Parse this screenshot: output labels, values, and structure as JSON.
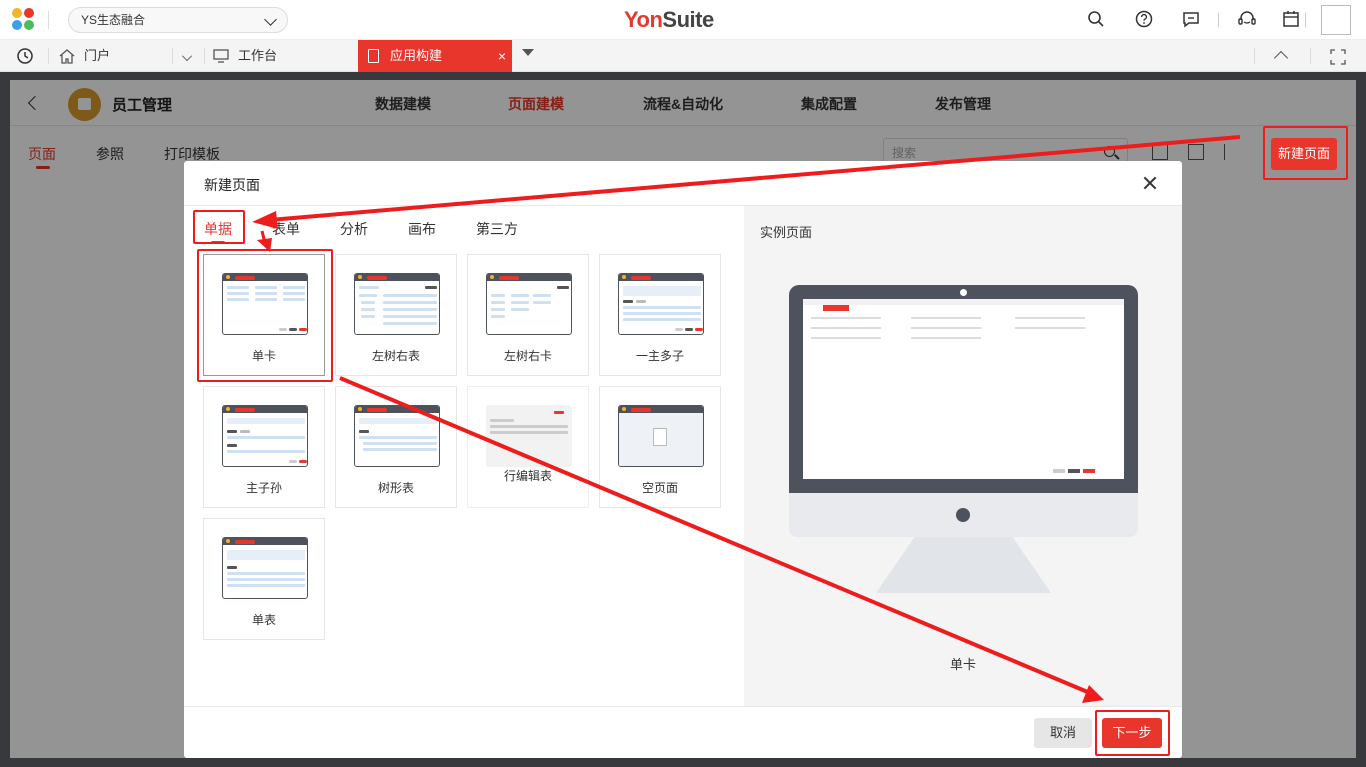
{
  "topbar": {
    "tenant": "YS生态融合",
    "brand_a": "Yon",
    "brand_b": "Suite",
    "icons": [
      "search-icon",
      "help-icon",
      "message-icon",
      "service-icon",
      "calendar-icon",
      "avatar"
    ]
  },
  "tabbar": {
    "portal": "门户",
    "workbench": "工作台",
    "active_tab": "应用构建",
    "close": "×"
  },
  "app": {
    "title": "员工管理",
    "nav": [
      "数据建模",
      "页面建模",
      "流程&自动化",
      "集成配置",
      "发布管理"
    ],
    "nav_active_index": 1,
    "subtabs": [
      "页面",
      "参照",
      "打印模板"
    ],
    "search_placeholder": "搜索",
    "new_page": "新建页面"
  },
  "modal": {
    "title": "新建页面",
    "categories": [
      "单据",
      "表单",
      "分析",
      "画布",
      "第三方"
    ],
    "templates": [
      "单卡",
      "左树右表",
      "左树右卡",
      "一主多子",
      "主子孙",
      "树形表",
      "行编辑表",
      "空页面",
      "单表"
    ],
    "preview_title": "实例页面",
    "preview_label": "单卡",
    "cancel": "取消",
    "next": "下一步"
  },
  "colors": {
    "accent": "#e9362c",
    "annotation": "#ee1c1c"
  }
}
